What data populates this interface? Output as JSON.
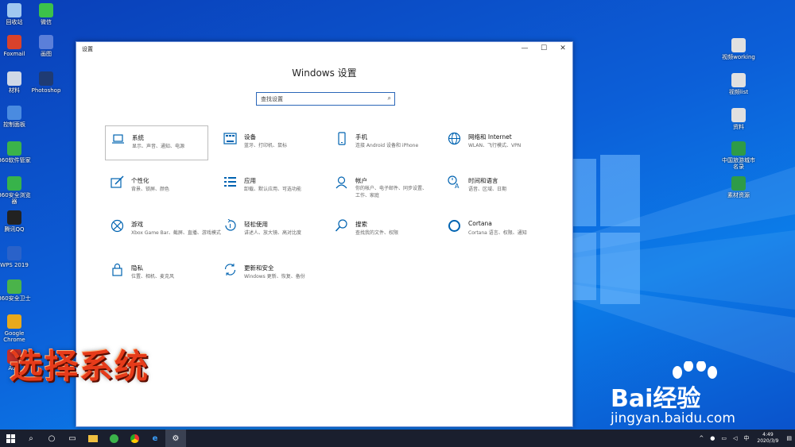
{
  "desktop": {
    "left_icons": [
      {
        "label": "回收站",
        "color": "#9fc7f0"
      },
      {
        "label": "微信",
        "color": "#3cc14a"
      },
      {
        "label": "Foxmail",
        "color": "#d9422b"
      },
      {
        "label": "画图",
        "color": "#5b7fd9"
      },
      {
        "label": "材料",
        "color": "#cfd8e6"
      },
      {
        "label": "Photoshop",
        "color": "#1f3b73"
      },
      {
        "label": "控制面板",
        "color": "#4a8be0"
      },
      {
        "label": "360软件管家",
        "color": "#3bb34a"
      },
      {
        "label": "360安全浏览器",
        "color": "#37b34a"
      },
      {
        "label": "腾讯QQ",
        "color": "#222222"
      },
      {
        "label": "WPS 2019",
        "color": "#2a62c9"
      },
      {
        "label": "360安全卫士",
        "color": "#4ab34a"
      },
      {
        "label": "Google Chrome",
        "color": "#e8a91c"
      },
      {
        "label": "Ac...",
        "color": "#c7302b"
      }
    ],
    "right_icons": [
      {
        "label": "视频working",
        "color": "#e0e0e0"
      },
      {
        "label": "视频list",
        "color": "#e0e0e0"
      },
      {
        "label": "资料",
        "color": "#e0e0e0"
      },
      {
        "label": "中国旅游城市名录",
        "color": "#2e9b48"
      },
      {
        "label": "素材资源",
        "color": "#2e9b48"
      }
    ]
  },
  "window": {
    "title": "设置",
    "heading": "Windows 设置",
    "controls": {
      "minimize": "—",
      "maximize": "☐",
      "close": "✕"
    },
    "search": {
      "placeholder": "查找设置",
      "icon": "search-icon"
    },
    "accent": "#0063b1",
    "tiles": [
      {
        "name": "系统",
        "desc": "显示、声音、通知、电源",
        "icon": "laptop-icon",
        "selected": true
      },
      {
        "name": "设备",
        "desc": "蓝牙、打印机、鼠标",
        "icon": "keyboard-icon"
      },
      {
        "name": "手机",
        "desc": "连接 Android 设备和 iPhone",
        "icon": "phone-icon"
      },
      {
        "name": "网络和 Internet",
        "desc": "WLAN、飞行模式、VPN",
        "icon": "globe-icon"
      },
      {
        "name": "个性化",
        "desc": "背景、锁屏、颜色",
        "icon": "paint-icon"
      },
      {
        "name": "应用",
        "desc": "卸载、默认应用、可选功能",
        "icon": "apps-icon"
      },
      {
        "name": "帐户",
        "desc": "你的帐户、电子邮件、同步设置、工作、家庭",
        "desc2": "家庭",
        "icon": "person-icon"
      },
      {
        "name": "时间和语言",
        "desc": "语音、区域、日期",
        "icon": "time-language-icon"
      },
      {
        "name": "游戏",
        "desc": "Xbox Game Bar、截屏、直播、游戏模式",
        "icon": "xbox-icon"
      },
      {
        "name": "轻松使用",
        "desc": "讲述人、放大镜、高对比度",
        "icon": "accessibility-icon"
      },
      {
        "name": "搜索",
        "desc": "查找我的文件、权限",
        "icon": "search-icon"
      },
      {
        "name": "Cortana",
        "desc": "Cortana 语言、权限、通知",
        "icon": "cortana-icon"
      },
      {
        "name": "隐私",
        "desc": "位置、相机、麦克风",
        "icon": "lock-icon"
      },
      {
        "name": "更新和安全",
        "desc": "Windows 更新、恢复、备份",
        "icon": "update-icon"
      }
    ]
  },
  "overlay": {
    "caption": "选择系统",
    "caption_color": "#e63b1a"
  },
  "watermark": {
    "brand": "Bai经验",
    "url": "jingyan.baidu.com"
  },
  "taskbar": {
    "items": [
      "start-icon",
      "search-icon",
      "cortana-icon",
      "task-view-icon",
      "explorer-icon",
      "360-browser-icon",
      "chrome-icon",
      "edge-icon",
      "settings-icon"
    ],
    "clock": {
      "time": "4:49",
      "date": "2020/3/9"
    },
    "input_method": "中"
  }
}
